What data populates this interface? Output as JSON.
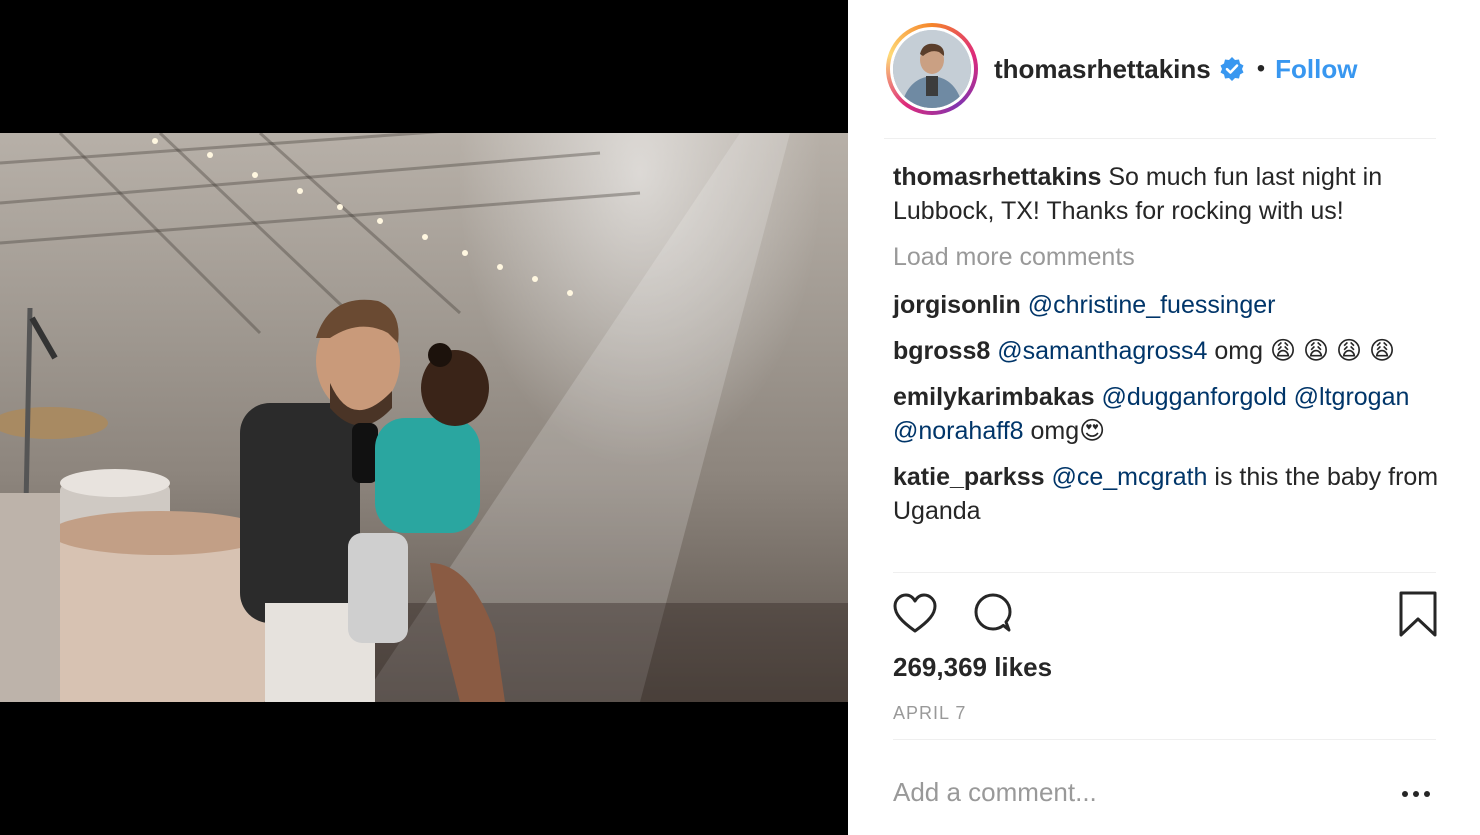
{
  "post": {
    "username": "thomasrhettakins",
    "follow_label": "Follow",
    "separator": "•",
    "verified_icon": "verified-badge-icon",
    "caption_user": "thomasrhettakins",
    "caption_text": " So much fun last night in Lubbock, TX! Thanks for rocking with us!",
    "load_more": "Load more comments",
    "likes": "269,369 likes",
    "date": "APRIL 7",
    "add_comment_placeholder": "Add a comment...",
    "more_icon": "more-options-icon"
  },
  "comments": [
    {
      "user": "jorgisonlin",
      "mentions": "@christine_fuessinger",
      "text": ""
    },
    {
      "user": "bgross8",
      "mentions": "@samanthagross4",
      "text": " omg 😩 😩 😩 😩"
    },
    {
      "user": "emilykarimbakas",
      "mentions": "@dugganforgold @ltgrogan @norahaff8",
      "text": " omg😍"
    },
    {
      "user": "katie_parkss",
      "mentions": "@ce_mcgrath",
      "text": " is this the baby from Uganda"
    }
  ],
  "icons": {
    "like": "heart-icon",
    "comment": "comment-bubble-icon",
    "save": "bookmark-icon"
  },
  "colors": {
    "link": "#3897f0",
    "mention": "#003569",
    "muted": "#999999",
    "text": "#262626"
  }
}
